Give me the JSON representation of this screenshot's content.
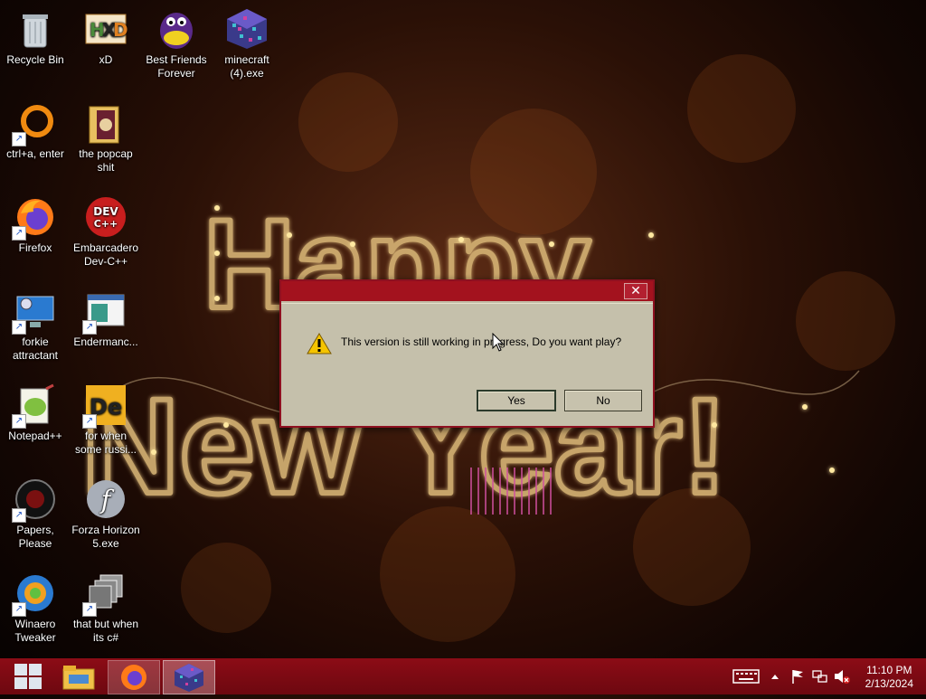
{
  "desktop": {
    "icons": [
      {
        "label": "Recycle Bin"
      },
      {
        "label": "xD"
      },
      {
        "label": "Best Friends Forever"
      },
      {
        "label": "minecraft (4).exe"
      },
      {
        "label": "ctrl+a, enter"
      },
      {
        "label": "the popcap shit"
      },
      {
        "label": "Firefox"
      },
      {
        "label": "Embarcadero Dev-C++"
      },
      {
        "label": "forkie attractant"
      },
      {
        "label": "Endermanc..."
      },
      {
        "label": "Notepad++"
      },
      {
        "label": "for when some russi..."
      },
      {
        "label": "Papers, Please"
      },
      {
        "label": "Forza Horizon 5.exe"
      },
      {
        "label": "Winaero Tweaker"
      },
      {
        "label": "that but when its c#"
      }
    ],
    "wallpaper": {
      "line1": "Happy",
      "line2": "New Year!"
    }
  },
  "dialog": {
    "title": "",
    "message": "This version is still working in progress, Do you want play?",
    "yes_label": "Yes",
    "no_label": "No",
    "close_glyph": "✕"
  },
  "taskbar": {
    "time": "11:10 PM",
    "date": "2/13/2024"
  }
}
